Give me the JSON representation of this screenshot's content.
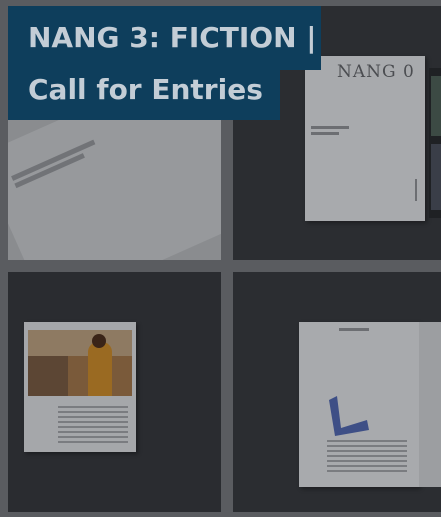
{
  "overlay": {
    "title_line1": "NANG 3: FICTION |",
    "title_line2": "Call for Entries",
    "background_color": "#0e3e5c",
    "text_color": "#c3cdd6"
  },
  "cover": {
    "title": "NANG 0"
  }
}
